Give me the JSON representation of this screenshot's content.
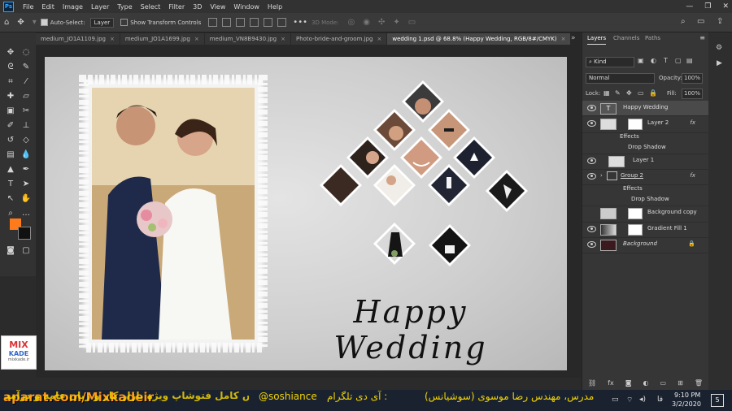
{
  "menubar": {
    "app_icon": "Ps",
    "items": [
      "File",
      "Edit",
      "Image",
      "Layer",
      "Type",
      "Select",
      "Filter",
      "3D",
      "View",
      "Window",
      "Help"
    ],
    "window_controls": [
      "—",
      "❐",
      "✕"
    ]
  },
  "options": {
    "auto_select_label": "Auto-Select:",
    "auto_select_value": "Layer",
    "transform_label": "Show Transform Controls",
    "mode_3d": "3D Mode:"
  },
  "tabs": [
    {
      "label": "medium_JO1A1109.jpg",
      "active": false
    },
    {
      "label": "medium_JO1A1699.jpg",
      "active": false
    },
    {
      "label": "medium_VN8B9430.jpg",
      "active": false
    },
    {
      "label": "Photo-bride-and-groom.jpg",
      "active": false
    },
    {
      "label": "wedding 1.psd @ 68.8% (Happy Wedding, RGB/8#/CMYK)",
      "active": true
    }
  ],
  "canvas": {
    "headline": "Happy Wedding",
    "logo_line1": "MIX",
    "logo_line2": "KADE",
    "logo_sub": "mixkade.ir"
  },
  "panel": {
    "tabs": [
      "Layers",
      "Channels",
      "Paths"
    ],
    "filter_kind": "Kind",
    "blend_mode": "Normal",
    "opacity_label": "Opacity:",
    "opacity_value": "100%",
    "lock_label": "Lock:",
    "fill_label": "Fill:",
    "fill_value": "100%",
    "layers": [
      {
        "name": "Happy Wedding",
        "type": "text",
        "selected": true
      },
      {
        "name": "Layer 2",
        "type": "image",
        "fx": "fx"
      },
      {
        "name": "Effects",
        "type": "effects"
      },
      {
        "name": "Drop Shadow",
        "type": "effect"
      },
      {
        "name": "Layer 1",
        "type": "image"
      },
      {
        "name": "Group 2",
        "type": "group",
        "fx": "fx"
      },
      {
        "name": "Effects",
        "type": "effects"
      },
      {
        "name": "Drop Shadow",
        "type": "effect"
      },
      {
        "name": "Background copy",
        "type": "image"
      },
      {
        "name": "Gradient Fill 1",
        "type": "fill"
      },
      {
        "name": "Background",
        "type": "background"
      }
    ]
  },
  "watermark": {
    "site": "aparat.com/Mixkadeir",
    "course": "آموزش کامل فتوشاپ ویژه بازار کار و زبان عامه و درآمد",
    "telegram": "@soshiance",
    "telegram_label": "آی دی تلگرام :",
    "teacher": "مدرس، مهندس رضا موسوی (سوشیانس)"
  },
  "taskbar": {
    "time": "9:10 PM",
    "date": "3/2/2020",
    "lang": "فا",
    "notif_count": "5"
  },
  "colors": {
    "foreground": "#ff7a1a",
    "background": "#111111"
  }
}
